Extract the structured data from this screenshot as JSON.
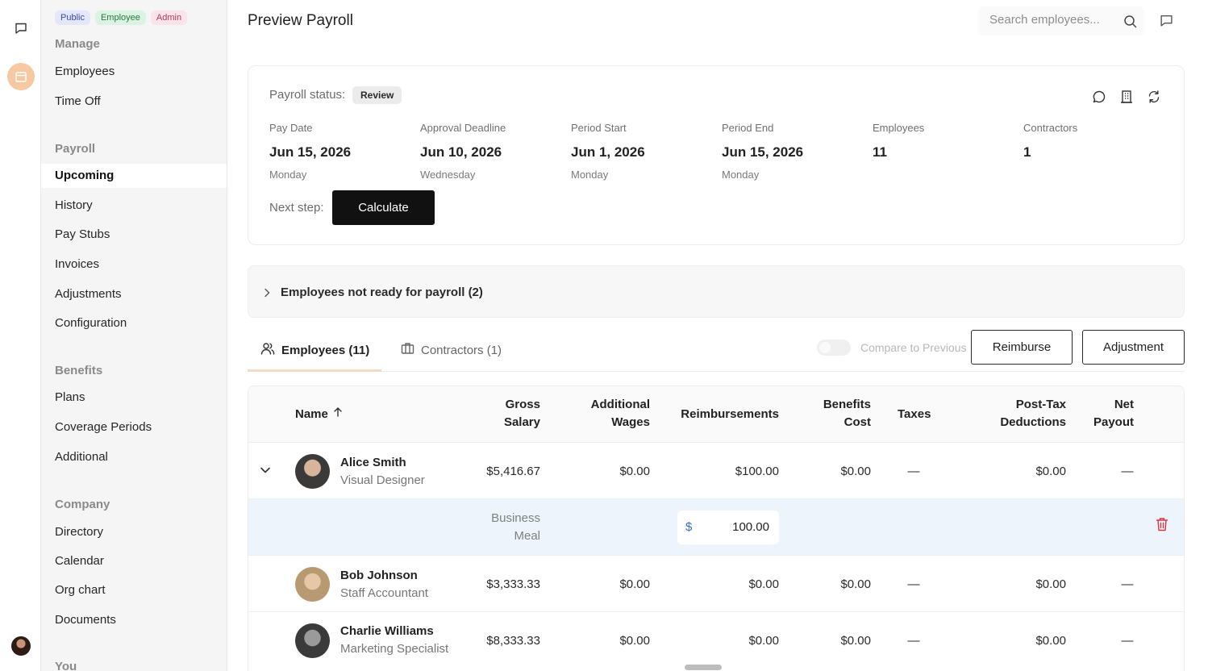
{
  "sidebar": {
    "badges": [
      "Public",
      "Employee",
      "Admin"
    ],
    "manage": {
      "title": "Manage",
      "items": [
        "Employees",
        "Time Off"
      ]
    },
    "payroll": {
      "title": "Payroll",
      "items": [
        "Upcoming",
        "History",
        "Pay Stubs",
        "Invoices",
        "Adjustments",
        "Configuration"
      ]
    },
    "benefits": {
      "title": "Benefits",
      "items": [
        "Plans",
        "Coverage Periods",
        "Additional"
      ]
    },
    "company": {
      "title": "Company",
      "items": [
        "Directory",
        "Calendar",
        "Org chart",
        "Documents"
      ]
    },
    "you": {
      "title": "You"
    }
  },
  "header": {
    "title": "Preview Payroll",
    "search_placeholder": "Search employees..."
  },
  "summary": {
    "status_label": "Payroll status:",
    "status_value": "Review",
    "fields": [
      {
        "label": "Pay Date",
        "value": "Jun 15, 2026",
        "sub": "Monday"
      },
      {
        "label": "Approval Deadline",
        "value": "Jun 10, 2026",
        "sub": "Wednesday"
      },
      {
        "label": "Period Start",
        "value": "Jun 1, 2026",
        "sub": "Monday"
      },
      {
        "label": "Period End",
        "value": "Jun 15, 2026",
        "sub": "Monday"
      },
      {
        "label": "Employees",
        "value": "11",
        "sub": ""
      },
      {
        "label": "Contractors",
        "value": "1",
        "sub": ""
      }
    ],
    "next_step_label": "Next step:",
    "calculate_label": "Calculate"
  },
  "not_ready": {
    "label": "Employees not ready for payroll (2)"
  },
  "tabs": {
    "employees": "Employees (11)",
    "contractors": "Contractors (1)",
    "compare_label": "Compare to Previous",
    "reimburse_label": "Reimburse",
    "adjustment_label": "Adjustment"
  },
  "table": {
    "headers": {
      "name": "Name",
      "gross_1": "Gross",
      "gross_2": "Salary",
      "additional_1": "Additional",
      "additional_2": "Wages",
      "reimbursements": "Reimbursements",
      "benefits_1": "Benefits",
      "benefits_2": "Cost",
      "taxes": "Taxes",
      "posttax_1": "Post-Tax",
      "posttax_2": "Deductions",
      "net_1": "Net",
      "net_2": "Payout"
    },
    "rows": [
      {
        "name": "Alice Smith",
        "role": "Visual Designer",
        "gross": "$5,416.67",
        "additional": "$0.00",
        "reimbursements": "$100.00",
        "benefits": "$0.00",
        "taxes": "—",
        "posttax": "$0.00",
        "net": "—"
      },
      {
        "name": "Bob Johnson",
        "role": "Staff Accountant",
        "gross": "$3,333.33",
        "additional": "$0.00",
        "reimbursements": "$0.00",
        "benefits": "$0.00",
        "taxes": "—",
        "posttax": "$0.00",
        "net": "—"
      },
      {
        "name": "Charlie Williams",
        "role": "Marketing Specialist",
        "gross": "$8,333.33",
        "additional": "$0.00",
        "reimbursements": "$0.00",
        "benefits": "$0.00",
        "taxes": "—",
        "posttax": "$0.00",
        "net": "—"
      }
    ],
    "expanded": {
      "label_1": "Business",
      "label_2": "Meal",
      "currency": "$",
      "amount": "100.00"
    }
  },
  "colors": {
    "accent_tab": "#f5d9c5",
    "calendar_rail": "#f6c9a3",
    "delete": "#d9363e"
  }
}
